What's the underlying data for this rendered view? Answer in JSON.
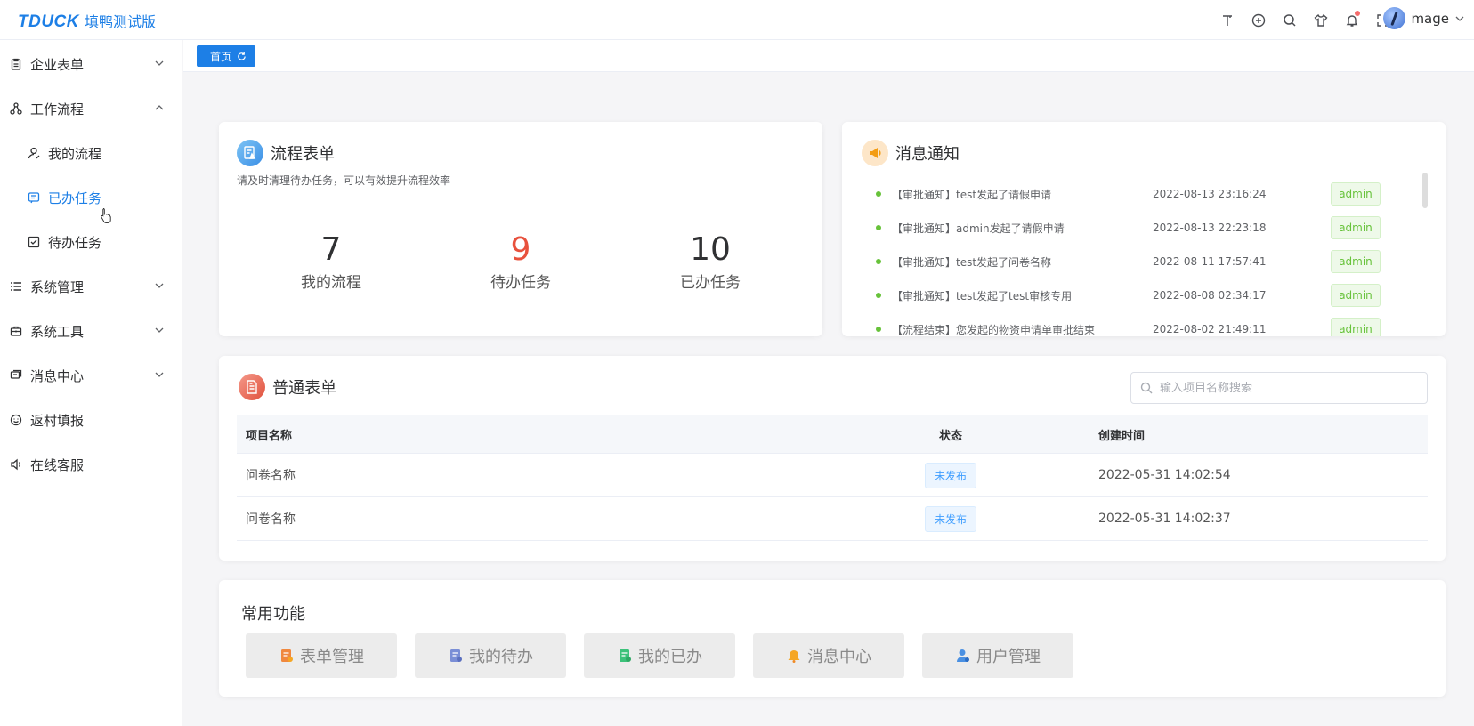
{
  "header": {
    "logo_mark": "TDUCK",
    "logo_text": "填鸭测试版",
    "icons": [
      "text-size-icon",
      "github-icon",
      "search-icon",
      "theme-icon",
      "bell-icon",
      "fullscreen-icon"
    ],
    "user_name": "mage"
  },
  "sidebar": {
    "items": [
      {
        "label": "企业表单",
        "icon": "clipboard-icon",
        "expanded": false
      },
      {
        "label": "工作流程",
        "icon": "flow-icon",
        "expanded": true
      },
      {
        "label": "我的流程",
        "icon": "user-icon",
        "sub": true
      },
      {
        "label": "已办任务",
        "icon": "done-list-icon",
        "sub": true,
        "active": true
      },
      {
        "label": "待办任务",
        "icon": "check-box-icon",
        "sub": true
      },
      {
        "label": "系统管理",
        "icon": "list-icon",
        "expanded": false
      },
      {
        "label": "系统工具",
        "icon": "toolbox-icon",
        "expanded": false
      },
      {
        "label": "消息中心",
        "icon": "chat-icon",
        "expanded": false
      },
      {
        "label": "返村填报",
        "icon": "smile-icon"
      },
      {
        "label": "在线客服",
        "icon": "speaker-icon"
      }
    ]
  },
  "tagbar": {
    "home_label": "首页"
  },
  "flow_card": {
    "title": "流程表单",
    "subtitle": "请及时清理待办任务，可以有效提升流程效率",
    "stats": [
      {
        "value": "7",
        "label": "我的流程"
      },
      {
        "value": "9",
        "label": "待办任务"
      },
      {
        "value": "10",
        "label": "已办任务"
      }
    ]
  },
  "msg_card": {
    "title": "消息通知",
    "messages": [
      {
        "text": "【审批通知】test发起了请假申请",
        "time": "2022-08-13 23:16:24",
        "user": "admin"
      },
      {
        "text": "【审批通知】admin发起了请假申请",
        "time": "2022-08-13 22:23:18",
        "user": "admin"
      },
      {
        "text": "【审批通知】test发起了问卷名称",
        "time": "2022-08-11 17:57:41",
        "user": "admin"
      },
      {
        "text": "【审批通知】test发起了test审核专用",
        "time": "2022-08-08 02:34:17",
        "user": "admin"
      },
      {
        "text": "【流程结束】您发起的物资申请单审批结束",
        "time": "2022-08-02 21:49:11",
        "user": "admin"
      }
    ]
  },
  "form_card": {
    "title": "普通表单",
    "search_placeholder": "输入项目名称搜索",
    "columns": [
      "项目名称",
      "状态",
      "创建时间"
    ],
    "rows": [
      {
        "name": "问卷名称",
        "status": "未发布",
        "created": "2022-05-31 14:02:54"
      },
      {
        "name": "问卷名称",
        "status": "未发布",
        "created": "2022-05-31 14:02:37"
      }
    ]
  },
  "func_card": {
    "title": "常用功能",
    "buttons": [
      {
        "label": "表单管理",
        "icon": "form-manage-icon",
        "color": "#f0883e"
      },
      {
        "label": "我的待办",
        "icon": "todo-icon",
        "color": "#7a8ed6"
      },
      {
        "label": "我的已办",
        "icon": "done-icon",
        "color": "#3cc27a"
      },
      {
        "label": "消息中心",
        "icon": "bell-icon",
        "color": "#f5a623"
      },
      {
        "label": "用户管理",
        "icon": "user-manage-icon",
        "color": "#4a90e2"
      }
    ]
  },
  "colors": {
    "primary": "#1d7fe6",
    "highlight": "#e8513d",
    "success": "#67c23a"
  }
}
